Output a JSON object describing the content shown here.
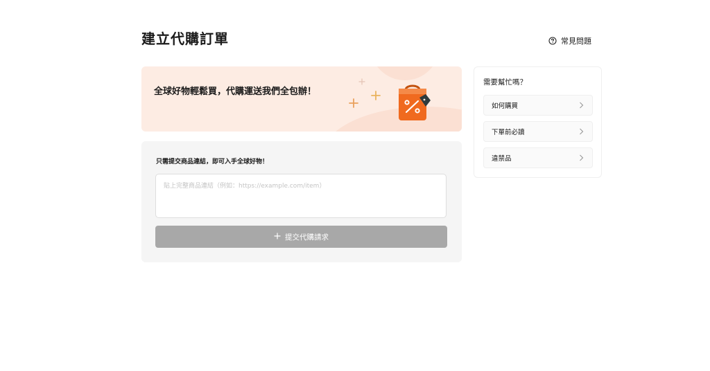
{
  "page": {
    "title": "建立代購訂單",
    "faq_label": "常見問題"
  },
  "banner": {
    "text": "全球好物輕鬆買，代購運送我們全包辦！",
    "icon": "shopping-bag-discount-icon"
  },
  "form": {
    "label": "只需提交商品連結，即可入手全球好物！",
    "input_placeholder": "貼上完整商品連結（例如：https://example.com/item）",
    "input_value": "",
    "submit_label": "提交代購請求",
    "submit_icon": "plus-icon",
    "submit_disabled": true
  },
  "help": {
    "title": "需要幫忙嗎？",
    "items": [
      {
        "label": "如何購買"
      },
      {
        "label": "下單前必讀"
      },
      {
        "label": "違禁品"
      }
    ]
  },
  "colors": {
    "banner_bg": "#fdece3",
    "accent_orange": "#f06a1f",
    "disabled_button": "#a8a8a8",
    "card_bg": "#f5f5f5"
  }
}
